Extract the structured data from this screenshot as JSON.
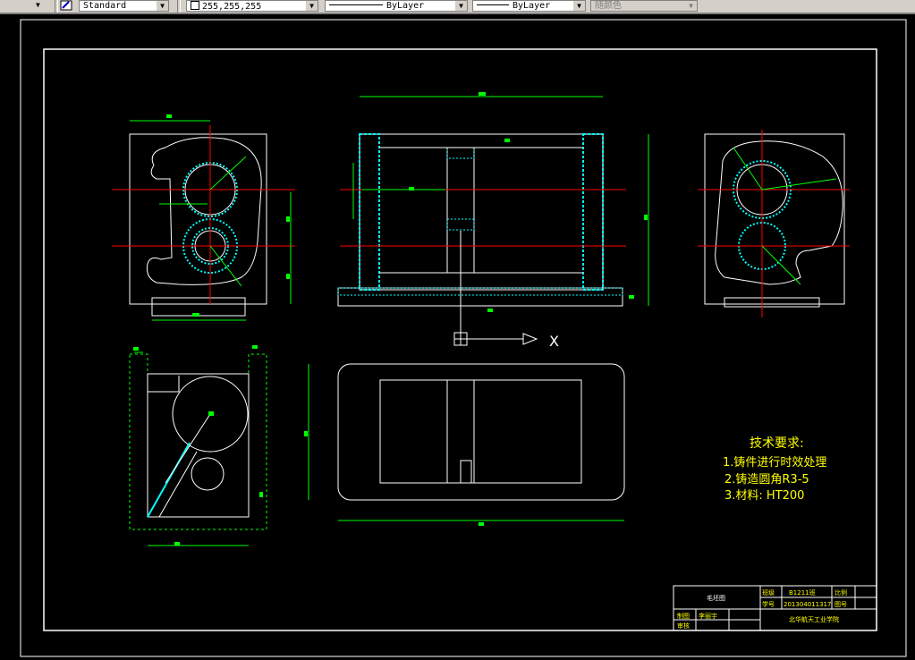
{
  "toolbar": {
    "style_value": "Standard",
    "color_value": "255,255,255",
    "linetype_value": "ByLayer",
    "lineweight_value": "ByLayer",
    "plotstyle_value": "随颜色"
  },
  "drawing": {
    "tech_title": "技术要求:",
    "tech_items": [
      "1.铸件进行时效处理",
      "2.铸造圆角R3-5",
      "3.材料: HT200"
    ],
    "ucs_label": "X"
  },
  "title_block": {
    "part_name": "毛坯图",
    "class_label": "班级",
    "class_value": "B1211班",
    "scale_label": "比例",
    "student_id_label": "学号",
    "student_id_value": "201304011317",
    "drawing_no_label": "图号",
    "drawn_label": "制图",
    "drawn_value": "李丽宇",
    "checked_label": "审核",
    "school": "北华航天工业学院"
  },
  "colors": {
    "toolbar_bg": "#d4d0c8",
    "canvas_bg": "#000000",
    "outline": "#ffffff",
    "dimension": "#00ff00",
    "centerline": "#ff0000",
    "section": "#00ffff",
    "text": "#ffff00"
  }
}
